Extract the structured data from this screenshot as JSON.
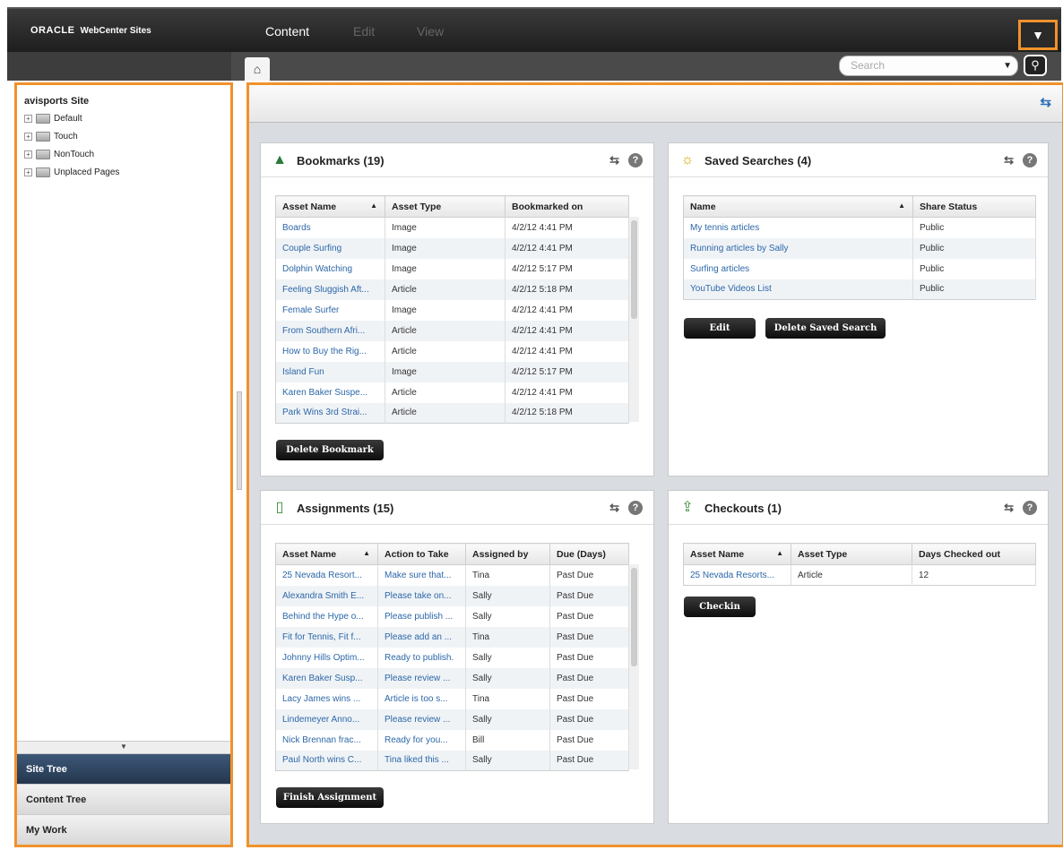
{
  "header": {
    "logo_brand": "ORACLE",
    "logo_product": "WebCenter Sites",
    "menu": {
      "content": "Content",
      "edit": "Edit",
      "view": "View"
    }
  },
  "tabbar": {
    "search_placeholder": "Search"
  },
  "left": {
    "site_title": "avisports Site",
    "tree": [
      "Default",
      "Touch",
      "NonTouch",
      "Unplaced Pages"
    ],
    "nav": {
      "site_tree": "Site Tree",
      "content_tree": "Content Tree",
      "my_work": "My Work"
    }
  },
  "bookmarks": {
    "title": "Bookmarks (19)",
    "columns": [
      "Asset Name",
      "Asset Type",
      "Bookmarked on"
    ],
    "rows": [
      [
        "Boards",
        "Image",
        "4/2/12 4:41 PM"
      ],
      [
        "Couple Surfing",
        "Image",
        "4/2/12 4:41 PM"
      ],
      [
        "Dolphin Watching",
        "Image",
        "4/2/12 5:17 PM"
      ],
      [
        "Feeling Sluggish Aft...",
        "Article",
        "4/2/12 5:18 PM"
      ],
      [
        "Female Surfer",
        "Image",
        "4/2/12 4:41 PM"
      ],
      [
        "From Southern Afri...",
        "Article",
        "4/2/12 4:41 PM"
      ],
      [
        "How to Buy the Rig...",
        "Article",
        "4/2/12 4:41 PM"
      ],
      [
        "Island Fun",
        "Image",
        "4/2/12 5:17 PM"
      ],
      [
        "Karen Baker Suspe...",
        "Article",
        "4/2/12 4:41 PM"
      ],
      [
        "Park Wins 3rd Strai...",
        "Article",
        "4/2/12 5:18 PM"
      ]
    ],
    "button": "Delete Bookmark"
  },
  "saved_searches": {
    "title": "Saved Searches (4)",
    "columns": [
      "Name",
      "Share Status"
    ],
    "rows": [
      [
        "My tennis articles",
        "Public"
      ],
      [
        "Running articles by Sally",
        "Public"
      ],
      [
        "Surfing articles",
        "Public"
      ],
      [
        "YouTube Videos List",
        "Public"
      ]
    ],
    "edit_button": "Edit",
    "delete_button": "Delete Saved Search"
  },
  "assignments": {
    "title": "Assignments (15)",
    "columns": [
      "Asset Name",
      "Action to Take",
      "Assigned by",
      "Due (Days)"
    ],
    "rows": [
      [
        "25 Nevada Resort...",
        "Make sure that...",
        "Tina",
        "Past Due"
      ],
      [
        "Alexandra Smith E...",
        "Please take on...",
        "Sally",
        "Past Due"
      ],
      [
        "Behind the Hype o...",
        "Please publish ...",
        "Sally",
        "Past Due"
      ],
      [
        "Fit for Tennis, Fit f...",
        "Please add an ...",
        "Tina",
        "Past Due"
      ],
      [
        "Johnny Hills Optim...",
        "Ready to publish.",
        "Sally",
        "Past Due"
      ],
      [
        "Karen Baker Susp...",
        "Please review ...",
        "Sally",
        "Past Due"
      ],
      [
        "Lacy James wins ...",
        "Article is too s...",
        "Tina",
        "Past Due"
      ],
      [
        "Lindemeyer Anno...",
        "Please review ...",
        "Sally",
        "Past Due"
      ],
      [
        "Nick Brennan frac...",
        "Ready for you...",
        "Bill",
        "Past Due"
      ],
      [
        "Paul North wins C...",
        "Tina liked this ...",
        "Sally",
        "Past Due"
      ]
    ],
    "button": "Finish Assignment"
  },
  "checkouts": {
    "title": "Checkouts (1)",
    "columns": [
      "Asset Name",
      "Asset Type",
      "Days Checked out"
    ],
    "rows": [
      [
        "25 Nevada Resorts...",
        "Article",
        "12"
      ]
    ],
    "button": "Checkin"
  },
  "colors": {
    "highlight": "#f0922c",
    "link": "#2c67a8",
    "active_nav": "#2f4664"
  }
}
